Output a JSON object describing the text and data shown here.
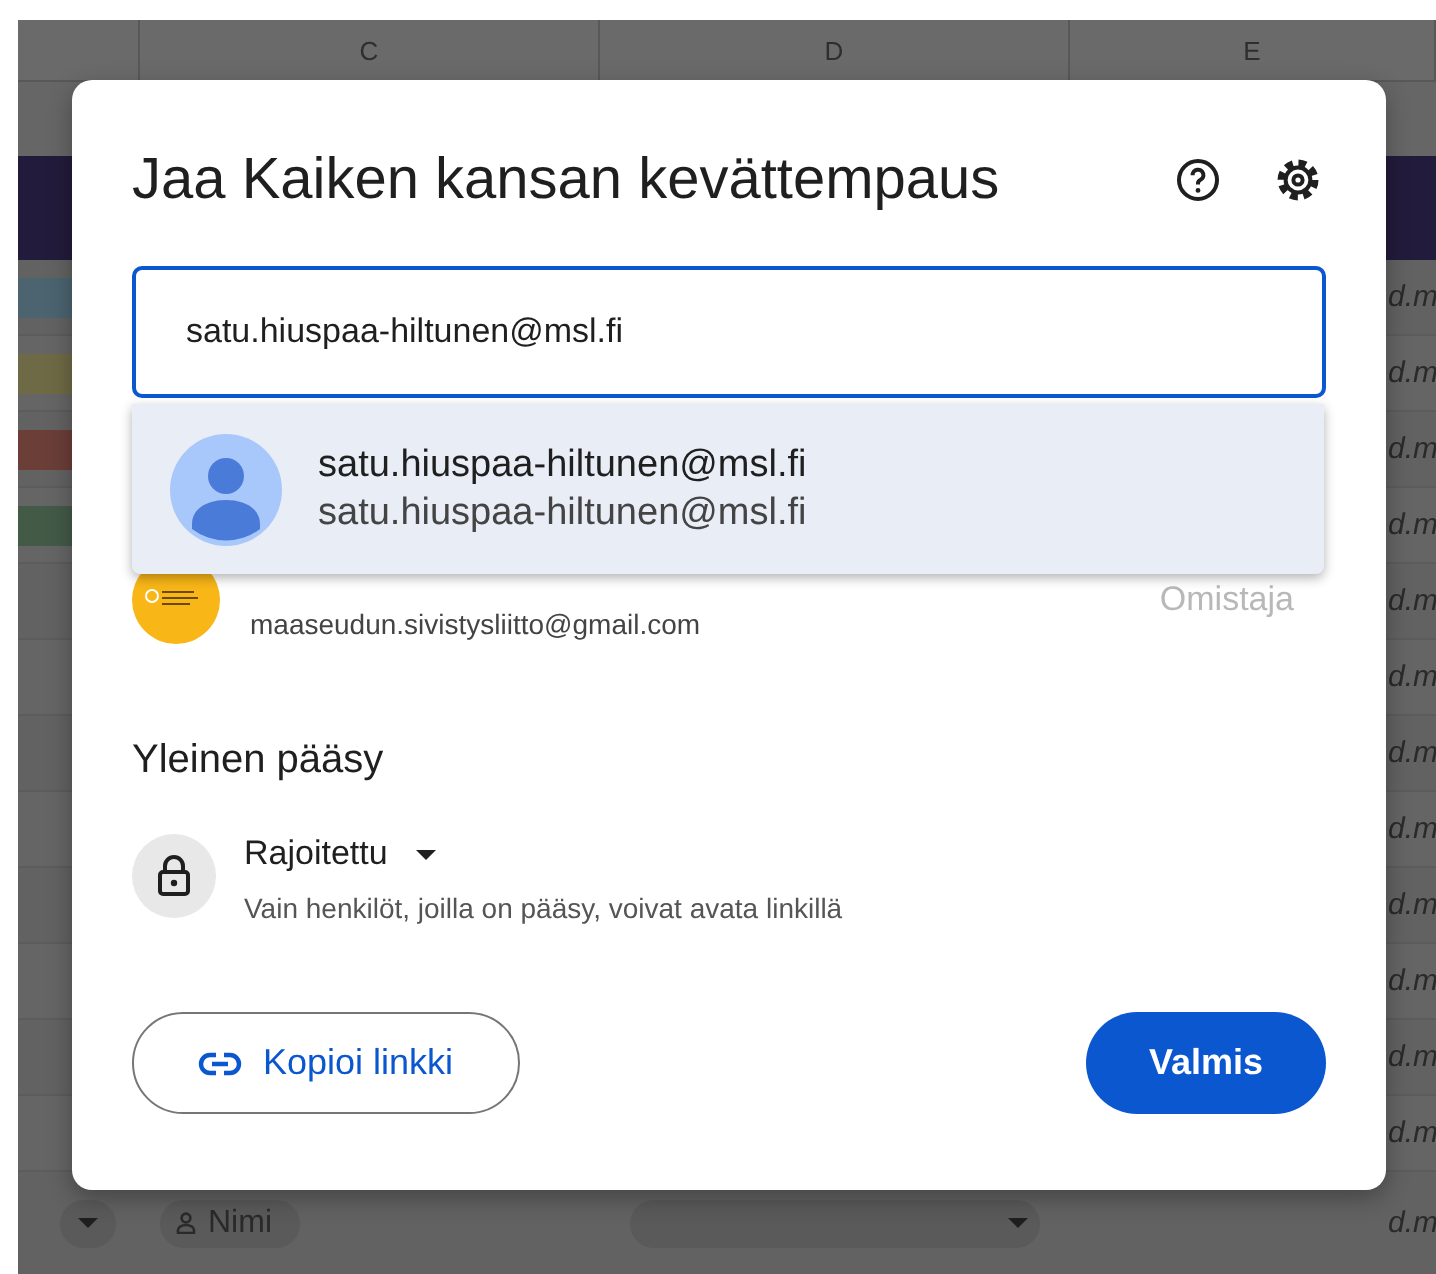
{
  "sheet": {
    "columns": [
      "C",
      "D",
      "E"
    ],
    "rows": [
      {
        "color": "#4b6470",
        "text": "d.m"
      },
      {
        "color": "#6e6a45",
        "text": "d.m"
      },
      {
        "color": "#6b3e38",
        "text": "d.m"
      },
      {
        "color": "#435a47",
        "text": "d.m"
      },
      {
        "text": "d.m"
      },
      {
        "text": "d.m"
      },
      {
        "text": "d.m"
      },
      {
        "text": "d.m"
      },
      {
        "text": "d.m"
      },
      {
        "text": "d.m"
      },
      {
        "text": "d.m"
      },
      {
        "text": "d.m"
      }
    ],
    "footer": {
      "chip": "Nimi",
      "text": "d.m"
    }
  },
  "dialog": {
    "title": "Jaa Kaiken kansan kevättempaus",
    "search": {
      "value": "satu.hiuspaa-hiltunen@msl.fi"
    },
    "suggestion": {
      "name": "satu.hiuspaa-hiltunen@msl.fi",
      "email": "satu.hiuspaa-hiltunen@msl.fi"
    },
    "people": [
      {
        "email": "maaseudun.sivistysliitto@gmail.com",
        "role": "Omistaja"
      }
    ],
    "general_access": {
      "heading": "Yleinen pääsy",
      "level": "Rajoitettu",
      "description": "Vain henkilöt, joilla on pääsy, voivat avata linkillä"
    },
    "buttons": [
      {
        "kind": "link",
        "label": "Kopioi linkki"
      },
      {
        "kind": "primary",
        "label": "Valmis"
      }
    ]
  }
}
